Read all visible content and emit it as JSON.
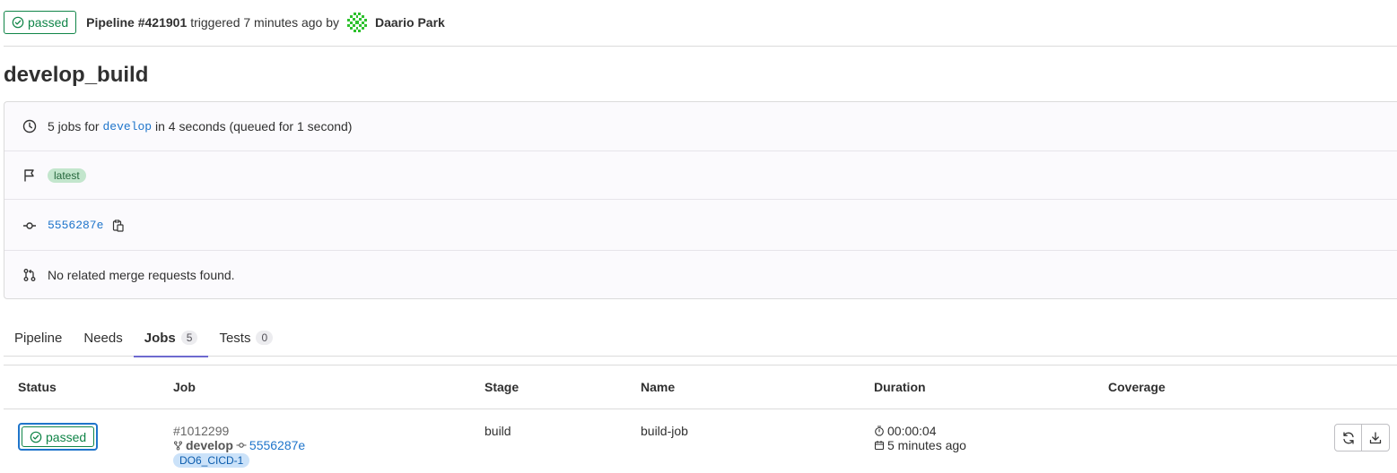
{
  "header": {
    "status": "passed",
    "pipeline_title": "Pipeline #421901",
    "triggered_text": "triggered 7 minutes ago by",
    "user_name": "Daario Park"
  },
  "page_title": "develop_build",
  "info": {
    "jobs_prefix": "5 jobs for",
    "branch": "develop",
    "jobs_suffix": "in 4 seconds (queued for 1 second)",
    "badge": "latest",
    "commit_sha": "5556287e",
    "merge_requests": "No related merge requests found."
  },
  "tabs": [
    {
      "label": "Pipeline",
      "count": null,
      "active": false
    },
    {
      "label": "Needs",
      "count": null,
      "active": false
    },
    {
      "label": "Jobs",
      "count": "5",
      "active": true
    },
    {
      "label": "Tests",
      "count": "0",
      "active": false
    }
  ],
  "table": {
    "headers": {
      "status": "Status",
      "job": "Job",
      "stage": "Stage",
      "name": "Name",
      "duration": "Duration",
      "coverage": "Coverage"
    },
    "rows": [
      {
        "status": "passed",
        "job_id": "#1012299",
        "branch": "develop",
        "sha": "5556287e",
        "tag": "DO6_CICD-1",
        "stage": "build",
        "name": "build-job",
        "duration": "00:00:04",
        "finished": "5 minutes ago",
        "coverage": ""
      }
    ]
  },
  "colors": {
    "success": "#108548",
    "link": "#1f75cb",
    "tab_active": "#6e6acf"
  },
  "icons": [
    "check-circle-icon",
    "clock-icon",
    "flag-icon",
    "commit-icon",
    "copy-icon",
    "merge-request-icon",
    "branch-icon",
    "timer-icon",
    "calendar-icon",
    "retry-icon",
    "download-icon"
  ]
}
